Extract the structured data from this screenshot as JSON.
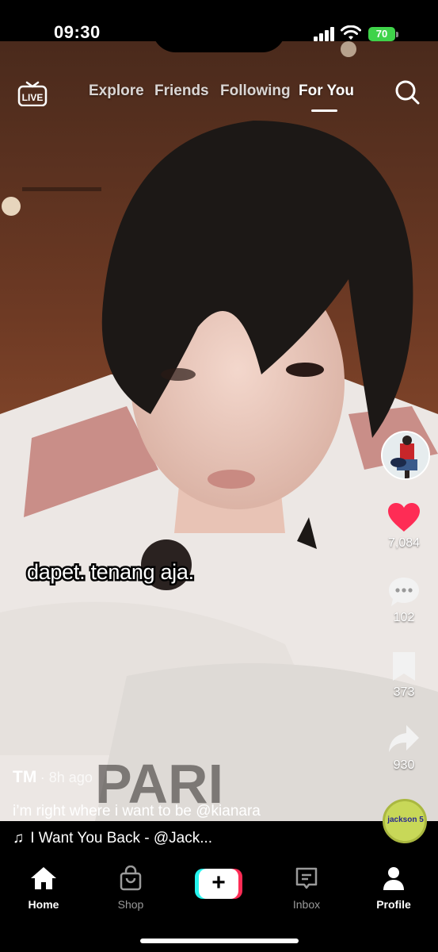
{
  "status_bar": {
    "time": "09:30",
    "battery": "70"
  },
  "top_nav": {
    "live_label": "LIVE",
    "tabs": [
      {
        "label": "Explore"
      },
      {
        "label": "Friends"
      },
      {
        "label": "Following"
      },
      {
        "label": "For You",
        "active": true
      }
    ]
  },
  "video": {
    "caption_overlay": "dapet. tenang aja."
  },
  "rail": {
    "likes": "7,084",
    "comments": "102",
    "bookmarks": "373",
    "shares": "930",
    "like_color": "#fe2c55"
  },
  "post": {
    "author": "TM",
    "time_ago": "8h ago",
    "description": "i’m right where i want to be @kianara",
    "music": "I Want You Back - @Jack..."
  },
  "music_disc": {
    "label": "jackson 5"
  },
  "bottom_nav": {
    "items": [
      {
        "label": "Home",
        "active": true
      },
      {
        "label": "Shop"
      },
      {
        "label": "Inbox"
      },
      {
        "label": "Profile",
        "active": true
      }
    ]
  }
}
